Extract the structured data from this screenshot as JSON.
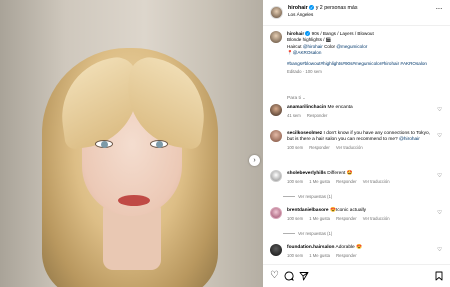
{
  "post": {
    "username": "hirohair",
    "header_suffix": "y 2 personas más",
    "location": "Los Ángeles",
    "caption": {
      "username": "hirohair",
      "line1": "90s / Bangs / Layers / Blowout",
      "line2": "Blonde highlights / 🎬",
      "line3_prefix": "Haircut",
      "line3_haircut": "@hirohair",
      "line3_mid": "Color",
      "line3_color": "@megumicolor",
      "line4": "📍@AKROsalon",
      "hashtags": "#bangs#blowout#highlights#90s#megumicolor#hirohair #AKROsalon",
      "meta": "Editado · 100 sem"
    },
    "para_ti": "Para ti"
  },
  "comments": [
    {
      "username": "anamarilinchacin",
      "text": "Me encanta",
      "time": "41 sem",
      "likes": "",
      "reply": "Responder",
      "translate": ""
    },
    {
      "username": "secilkoseolmez",
      "text": "I don't know if you have any connections to Tokyo, but is there a hair salon you can recommend to me?",
      "mention": "@hirohair",
      "time": "100 sem",
      "likes": "",
      "reply": "Responder",
      "translate": "Ver traducción"
    },
    {
      "username": "sholebeverlyhills",
      "text": "Different 🤩",
      "time": "100 sem",
      "likes": "1 Me gusta",
      "reply": "Responder",
      "translate": "Ver traducción",
      "replies": "Ver respuestas (1)"
    },
    {
      "username": "brentdanielbasore",
      "text": "😍Iconic actually",
      "time": "100 sem",
      "likes": "1 Me gusta",
      "reply": "Responder",
      "translate": "Ver traducción",
      "replies": "Ver respuestas (1)"
    },
    {
      "username": "foundation.hairsalon",
      "text": "Adorable 😍",
      "time": "100 sem",
      "likes": "1 Me gusta",
      "reply": "Responder",
      "translate": ""
    }
  ],
  "icons": {
    "more": "more-options-icon",
    "verified": "verified-badge-icon",
    "like": "heart-icon",
    "comment": "comment-icon",
    "share": "share-icon",
    "save": "bookmark-icon",
    "next": "chevron-right-icon"
  },
  "colors": {
    "link": "#00376b",
    "verified": "#0095f6",
    "muted": "#737373"
  }
}
